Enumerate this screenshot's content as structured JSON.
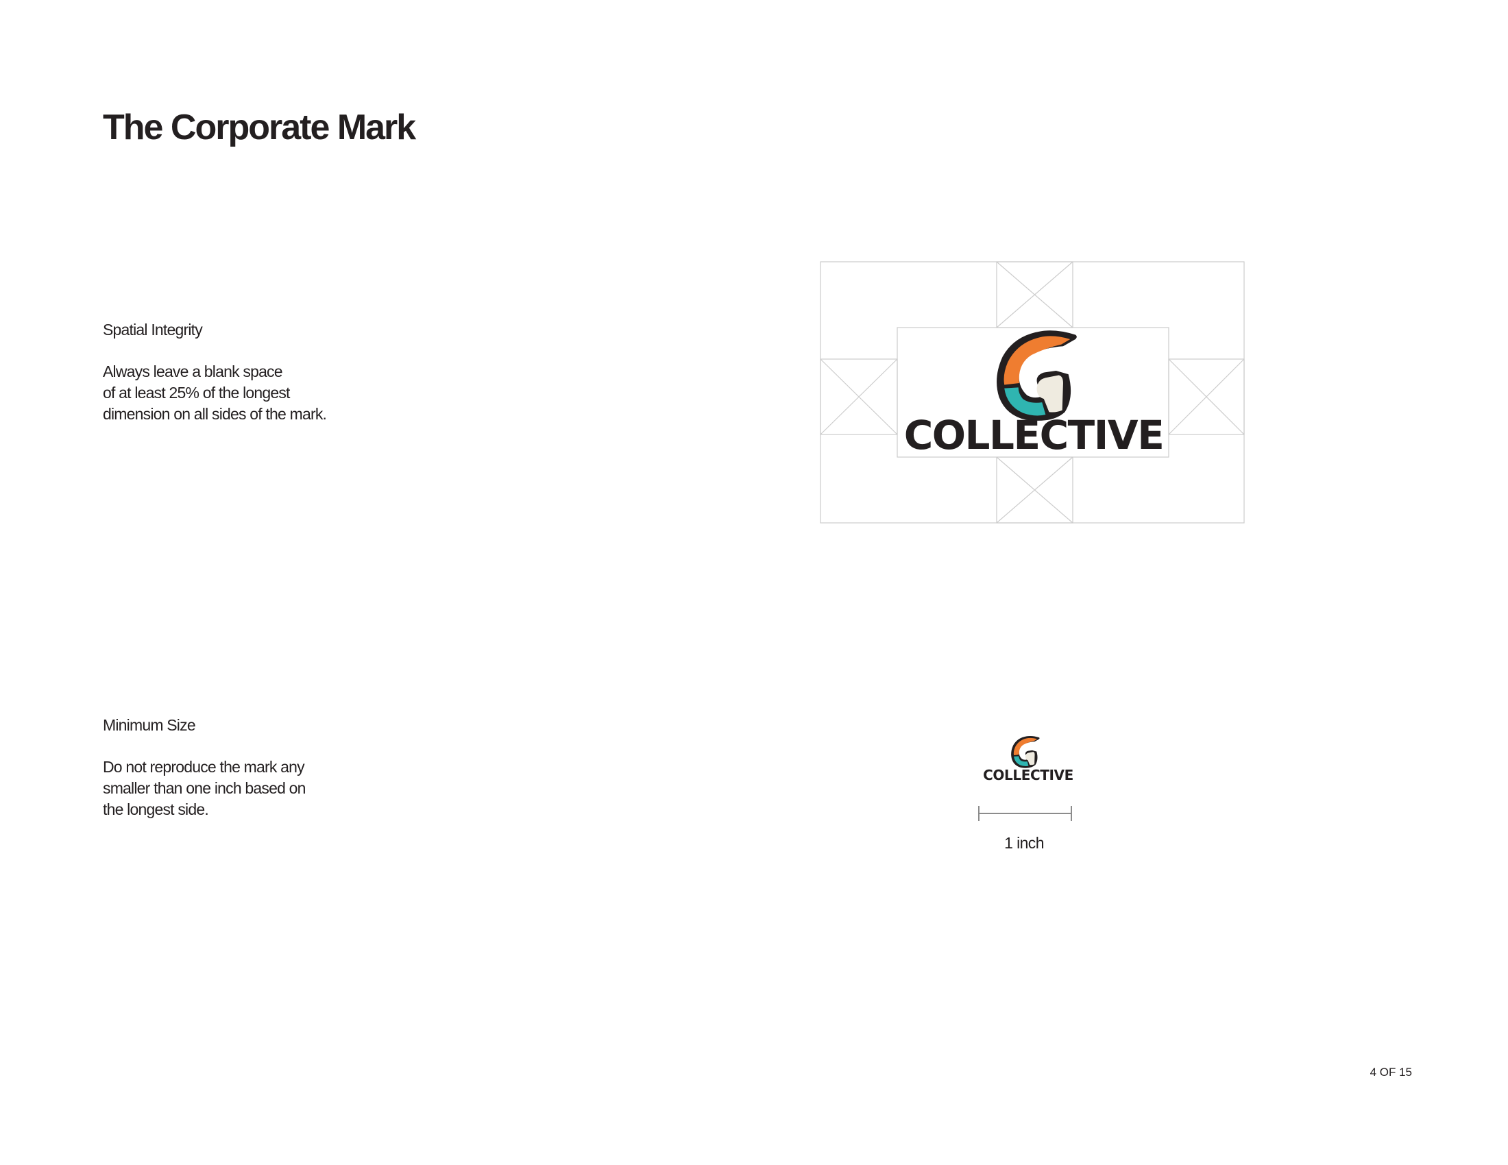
{
  "page": {
    "title": "The Corporate Mark",
    "page_number": "4 OF 15"
  },
  "sections": {
    "spatial_integrity": {
      "heading": "Spatial Integrity",
      "body_lines": [
        "Always leave a blank space",
        "of at least 25% of the longest",
        "dimension on all sides of the mark."
      ]
    },
    "minimum_size": {
      "heading": "Minimum Size",
      "body_lines": [
        "Do not reproduce the mark any",
        "smaller than one inch based on",
        "the longest side."
      ]
    }
  },
  "logo": {
    "wordmark": "COLLECTIVE",
    "icon": "g-monogram-icon",
    "colors": {
      "orange": "#ef7d30",
      "teal": "#2fb5b1",
      "cream": "#efebe0",
      "outline": "#231f20"
    }
  },
  "minimum_size_ruler": {
    "label": "1 inch"
  },
  "colors": {
    "text": "#231f20",
    "guide_lines": "#cccccc",
    "background": "#ffffff"
  }
}
